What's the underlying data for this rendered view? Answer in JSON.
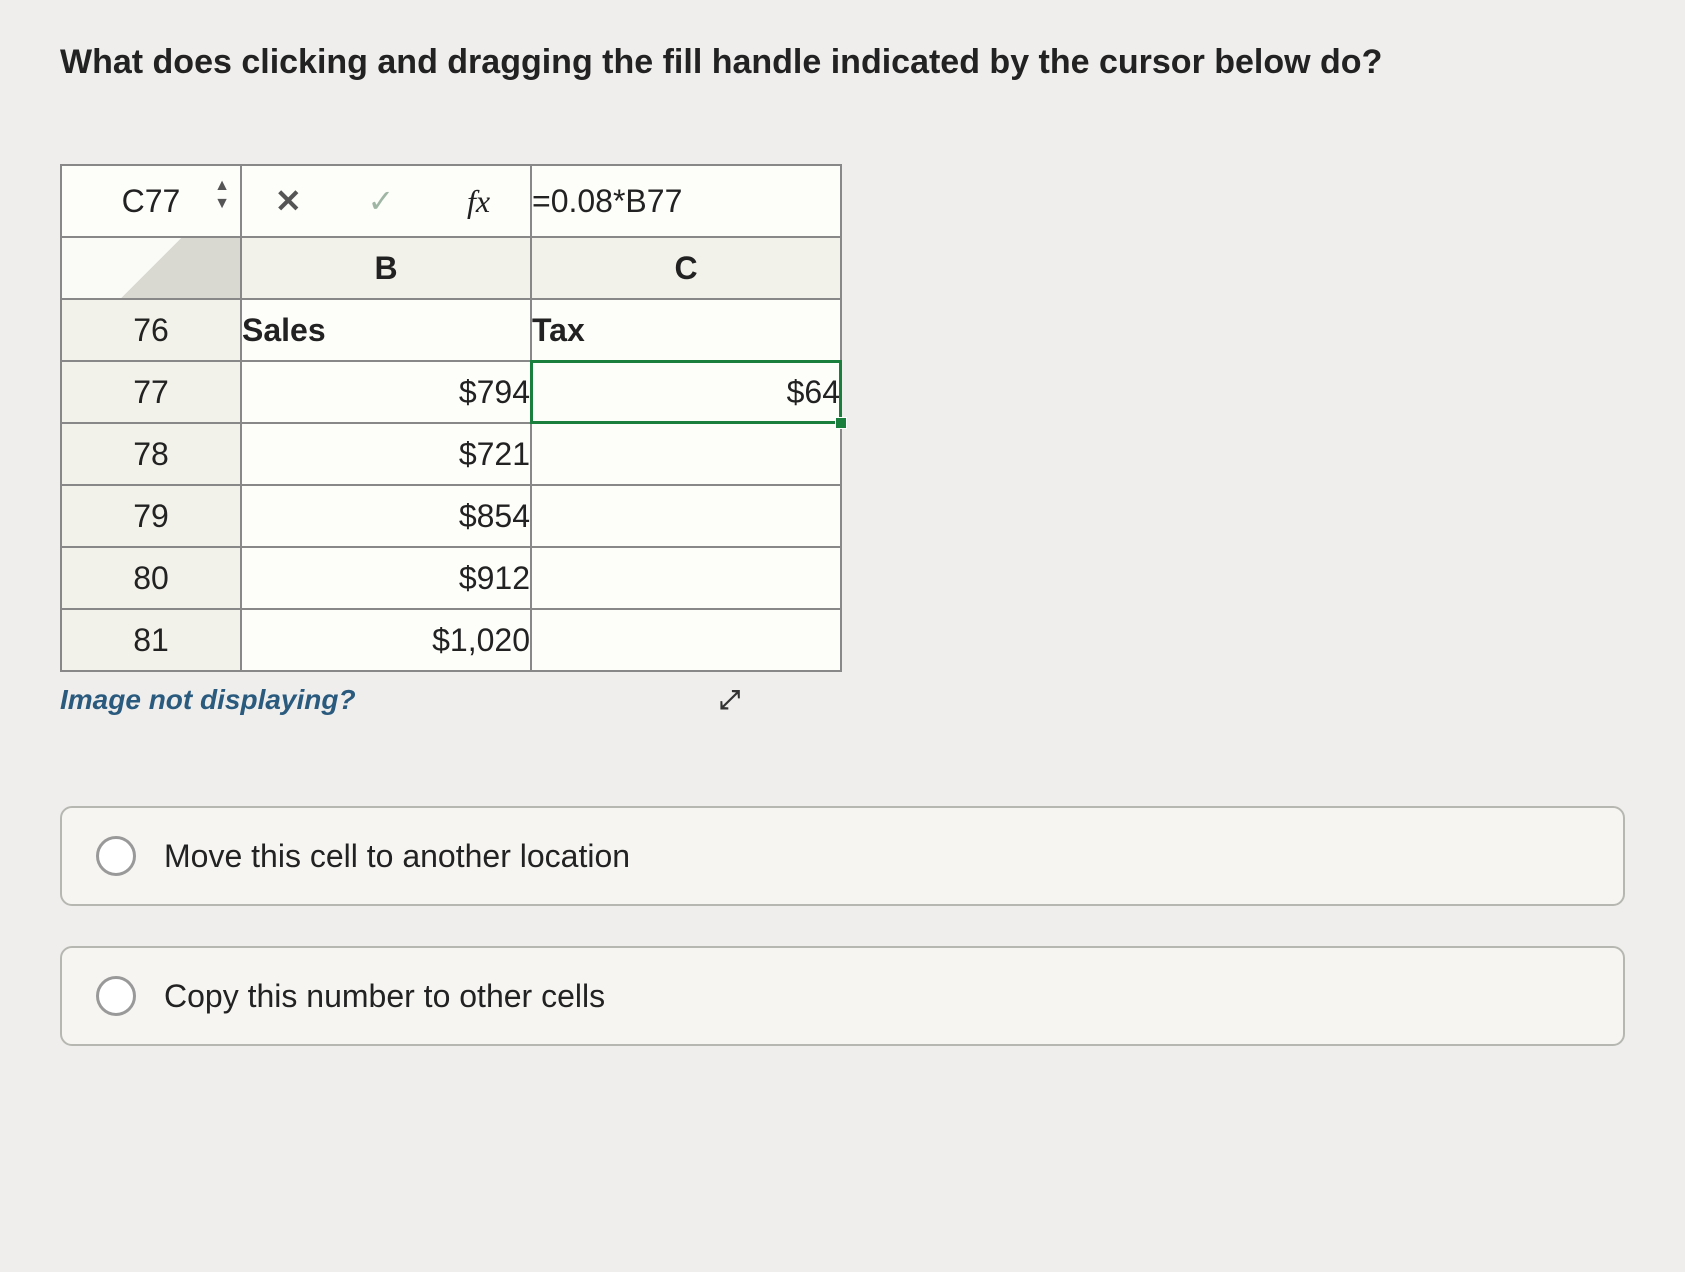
{
  "question": "What does clicking and dragging the fill handle indicated by the cursor below do?",
  "formula_bar": {
    "name_box": "C77",
    "cancel_glyph": "✕",
    "ok_glyph": "✓",
    "fx_label": "fx",
    "formula": "=0.08*B77"
  },
  "columns": {
    "b": "B",
    "c": "C"
  },
  "rows": [
    {
      "num": "76",
      "b": "Sales",
      "c": "Tax",
      "b_align": "left",
      "c_align": "left",
      "b_bold": true,
      "c_bold": true,
      "selected": false
    },
    {
      "num": "77",
      "b": "$794",
      "c": "$64",
      "b_align": "right",
      "c_align": "right",
      "b_bold": false,
      "c_bold": false,
      "selected": true
    },
    {
      "num": "78",
      "b": "$721",
      "c": "",
      "b_align": "right",
      "c_align": "right",
      "b_bold": false,
      "c_bold": false,
      "selected": false
    },
    {
      "num": "79",
      "b": "$854",
      "c": "",
      "b_align": "right",
      "c_align": "right",
      "b_bold": false,
      "c_bold": false,
      "selected": false
    },
    {
      "num": "80",
      "b": "$912",
      "c": "",
      "b_align": "right",
      "c_align": "right",
      "b_bold": false,
      "c_bold": false,
      "selected": false
    },
    {
      "num": "81",
      "b": "$1,020",
      "c": "",
      "b_align": "right",
      "c_align": "right",
      "b_bold": false,
      "c_bold": false,
      "selected": false
    }
  ],
  "image_help": "Image not displaying?",
  "options": [
    "Move this cell to another location",
    "Copy this number to other cells"
  ]
}
